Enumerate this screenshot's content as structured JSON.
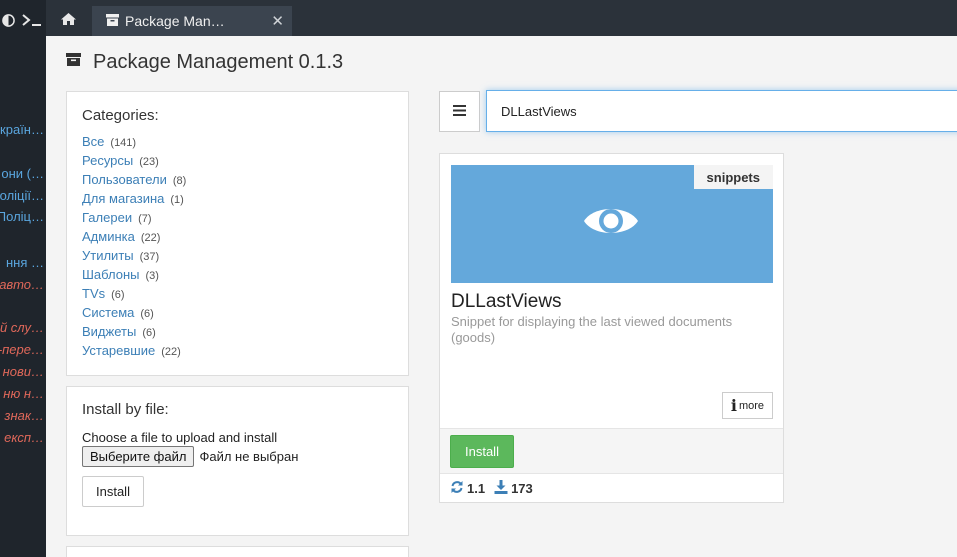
{
  "sidebar": {
    "top_icons": [
      "half-circle-icon",
      "terminal-icon"
    ],
    "items": [
      {
        "text": "країн…",
        "style": "blue"
      },
      {
        "text": "они (…",
        "style": "blue"
      },
      {
        "text": "оліції…",
        "style": "blue"
      },
      {
        "text": "Поліц…",
        "style": "blue"
      },
      {
        "text": "ння …",
        "style": "blue"
      },
      {
        "text": "авто…",
        "style": "red"
      },
      {
        "text": "й слу…",
        "style": "red"
      },
      {
        "text": "-пере…",
        "style": "red"
      },
      {
        "text": "нови…",
        "style": "red"
      },
      {
        "text": "ню н…",
        "style": "red"
      },
      {
        "text": "знак…",
        "style": "red"
      },
      {
        "text": "експ…",
        "style": "red"
      }
    ]
  },
  "tabs": {
    "home_icon": "home-icon",
    "package_icon": "archive-icon",
    "package_label": "Package Man…",
    "close_label": "✕"
  },
  "page": {
    "title": "Package Management 0.1.3",
    "title_icon": "archive-icon"
  },
  "categories": {
    "title": "Categories:",
    "items": [
      {
        "label": "Все",
        "count": "(141)"
      },
      {
        "label": "Ресурсы",
        "count": "(23)"
      },
      {
        "label": "Пользователи",
        "count": "(8)"
      },
      {
        "label": "Для магазина",
        "count": "(1)"
      },
      {
        "label": "Галереи",
        "count": "(7)"
      },
      {
        "label": "Админка",
        "count": "(22)"
      },
      {
        "label": "Утилиты",
        "count": "(37)"
      },
      {
        "label": "Шаблоны",
        "count": "(3)"
      },
      {
        "label": "TVs",
        "count": "(6)"
      },
      {
        "label": "Система",
        "count": "(6)"
      },
      {
        "label": "Виджеты",
        "count": "(6)"
      },
      {
        "label": "Устаревшие",
        "count": "(22)"
      }
    ]
  },
  "install_by_file": {
    "title": "Install by file:",
    "instruction": "Choose a file to upload and install",
    "choose_button": "Выберите файл",
    "file_status": "Файл не выбран",
    "install_button": "Install"
  },
  "search": {
    "menu_icon": "hamburger-icon",
    "value": "DLLastViews"
  },
  "package_card": {
    "badge": "snippets",
    "thumb_icon": "eye-icon",
    "name": "DLLastViews",
    "description": "Snippet for displaying the last viewed documents (goods)",
    "more_label": "more",
    "install_label": "Install",
    "version": "1.1",
    "downloads": "173",
    "colors": {
      "thumb": "#64a8db",
      "install": "#5cb85c",
      "link": "#3c7fb6"
    }
  }
}
